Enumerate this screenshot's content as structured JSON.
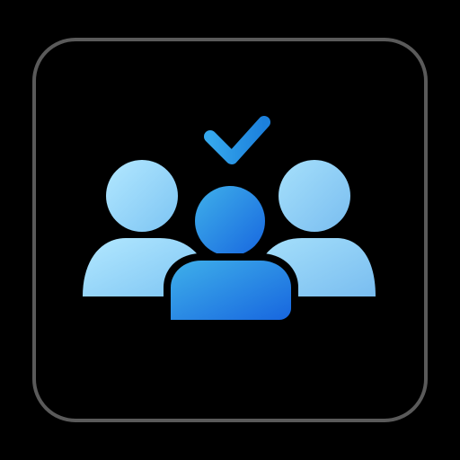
{
  "icon": {
    "name": "group-approved-icon",
    "colors": {
      "background": "#000000",
      "frame_stroke": "#5a5a5a",
      "light_blue_top": "#a9e4ff",
      "light_blue_bottom": "#7cc6f5",
      "center_top": "#3aa6e6",
      "center_bottom": "#1565e0",
      "checkmark_start": "#2fa0ea",
      "checkmark_end": "#1a7ad8"
    }
  }
}
